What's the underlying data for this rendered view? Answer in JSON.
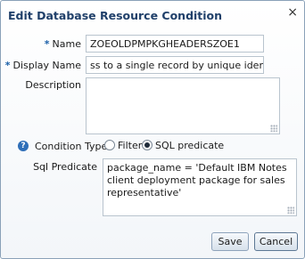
{
  "dialog": {
    "title": "Edit Database Resource Condition",
    "close_glyph": "×"
  },
  "fields": {
    "required_marker": "*",
    "name": {
      "label": "Name",
      "value": "ZOEOLDPMPKGHEADERSZOE1"
    },
    "display_name": {
      "label": "Display Name",
      "value": "ss to a single record by unique identifier."
    },
    "description": {
      "label": "Description",
      "value": ""
    },
    "condition_type": {
      "label": "Condition Type",
      "options": [
        {
          "label": "Filter",
          "selected": false
        },
        {
          "label": "SQL predicate",
          "selected": true
        }
      ]
    },
    "sql_predicate": {
      "label": "Sql Predicate",
      "value": "package_name = 'Default IBM Notes client deployment package for sales representative'"
    }
  },
  "help_glyph": "?",
  "buttons": {
    "save": "Save",
    "cancel": "Cancel"
  }
}
